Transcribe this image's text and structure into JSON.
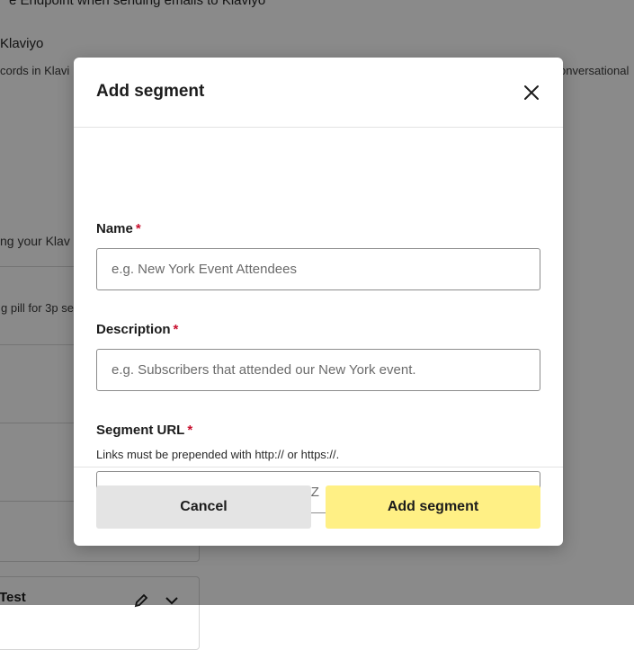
{
  "background": {
    "line1": "e Endpoint when sending emails to Klaviyo",
    "line2": "Klaviyo",
    "line3": "cords in Klavi",
    "line3_right": "onversational",
    "line4": "ng your Klav",
    "card1_text": "g pill for 3p se",
    "card5_title": "Test"
  },
  "modal": {
    "title": "Add segment",
    "close_icon": "close-icon",
    "required_marker": "*",
    "fields": {
      "name": {
        "label": "Name",
        "placeholder": "e.g. New York Event Attendees",
        "value": ""
      },
      "description": {
        "label": "Description",
        "placeholder": "e.g. Subscribers that attended our New York event.",
        "value": ""
      },
      "url": {
        "label": "Segment URL",
        "helper": "Links must be prepended with http:// or https://.",
        "placeholder": "e.g. https://klaviyo.com/list/KJgTvZ",
        "value": ""
      }
    },
    "buttons": {
      "cancel": "Cancel",
      "submit": "Add segment"
    }
  },
  "colors": {
    "primary_button": "#fff085",
    "secondary_button": "#e4e4e4",
    "required": "#c8102e",
    "overlay": "rgba(0,0,0,0.46)"
  }
}
